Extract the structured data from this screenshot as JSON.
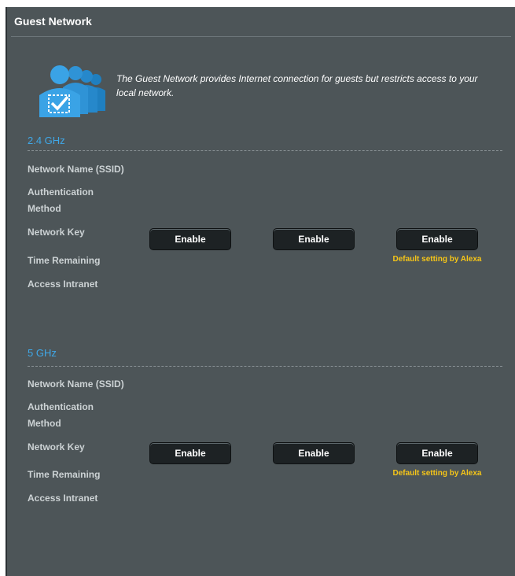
{
  "header": {
    "title": "Guest Network"
  },
  "intro": {
    "icon": "guest-users-icon",
    "description": "The Guest Network provides Internet connection for guests but restricts access to your local network."
  },
  "bands": [
    {
      "title": "2.4 GHz",
      "labels": [
        "Network Name (SSID)",
        "Authentication",
        "Method",
        "Network Key",
        "Time Remaining",
        "Access Intranet"
      ],
      "buttons": [
        "Enable",
        "Enable",
        "Enable"
      ],
      "note": "Default setting by Alexa"
    },
    {
      "title": "5 GHz",
      "labels": [
        "Network Name (SSID)",
        "Authentication",
        "Method",
        "Network Key",
        "Time Remaining",
        "Access Intranet"
      ],
      "buttons": [
        "Enable",
        "Enable",
        "Enable"
      ],
      "note": "Default setting by Alexa"
    }
  ],
  "colors": {
    "panel_bg": "#4d5558",
    "band_title": "#3fa8e8",
    "note": "#f5c518",
    "button_bg": "#1d2224"
  }
}
